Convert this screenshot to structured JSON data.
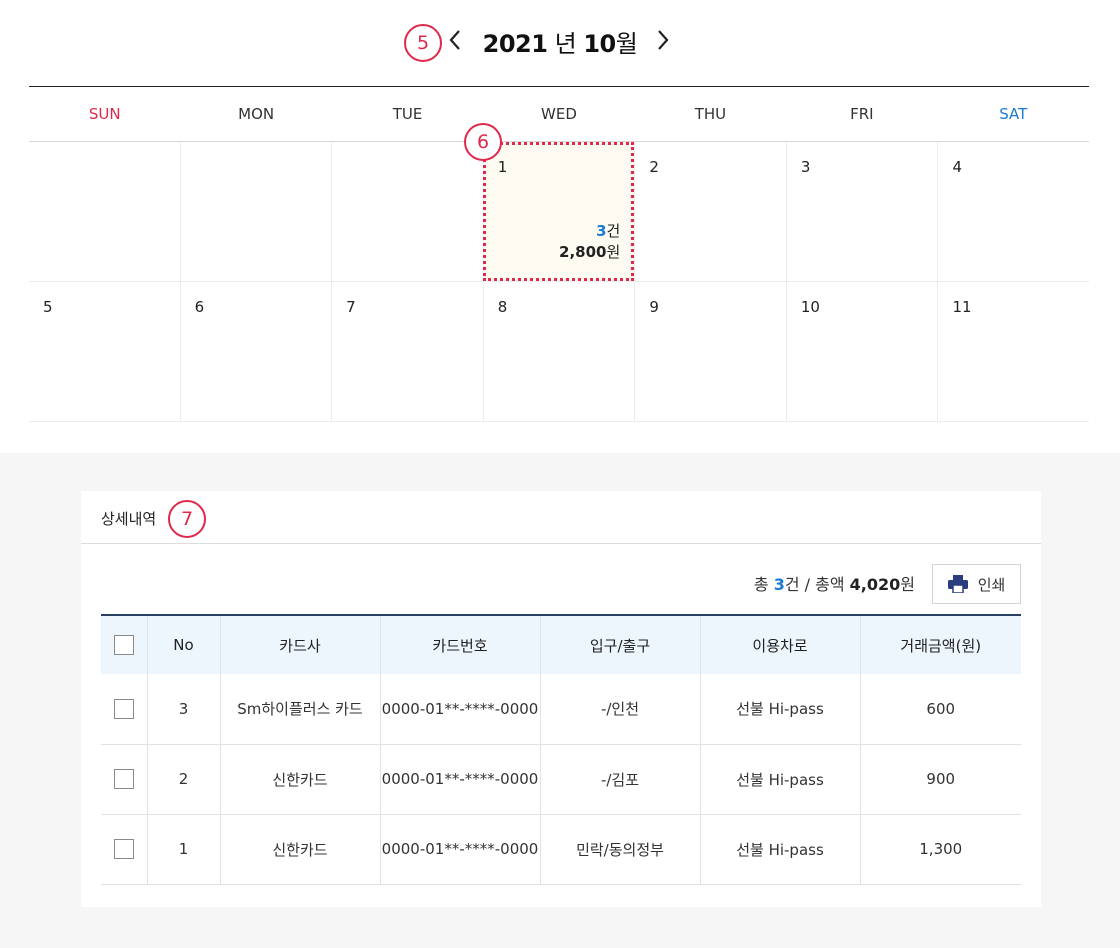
{
  "calendar": {
    "year": "2021",
    "year_unit": "년",
    "month": "10",
    "month_unit": "월",
    "weekdays": [
      "SUN",
      "MON",
      "TUE",
      "WED",
      "THU",
      "FRI",
      "SAT"
    ],
    "weeks": [
      [
        "",
        "",
        "",
        "1",
        "2",
        "3",
        "4"
      ],
      [
        "5",
        "6",
        "7",
        "8",
        "9",
        "10",
        "11"
      ]
    ],
    "selected_day": {
      "count": "3",
      "count_unit": "건",
      "amount": "2,800",
      "amount_unit": "원"
    }
  },
  "badges": {
    "b5": "5",
    "b6": "6",
    "b7": "7"
  },
  "detail": {
    "title": "상세내역",
    "summary": {
      "total_prefix": "총 ",
      "count": "3",
      "count_suffix": "건 / 총액 ",
      "amount": "4,020",
      "amount_suffix": "원"
    },
    "print_label": "인쇄",
    "columns": [
      "No",
      "카드사",
      "카드번호",
      "입구/출구",
      "이용차로",
      "거래금액(원)"
    ],
    "rows": [
      {
        "no": "3",
        "card_company": "Sm하이플러스 카드",
        "card_number": "0000-01**-****-0000",
        "entry_exit": "-/인천",
        "lane": "선불 Hi-pass",
        "amount": "600"
      },
      {
        "no": "2",
        "card_company": "신한카드",
        "card_number": "0000-01**-****-0000",
        "entry_exit": "-/김포",
        "lane": "선불 Hi-pass",
        "amount": "900"
      },
      {
        "no": "1",
        "card_company": "신한카드",
        "card_number": "0000-01**-****-0000",
        "entry_exit": "민락/동의정부",
        "lane": "선불 Hi-pass",
        "amount": "1,300"
      }
    ]
  },
  "colors": {
    "accent_red": "#e0284a",
    "accent_blue": "#1a7ad4",
    "header_navy": "#28405f"
  }
}
